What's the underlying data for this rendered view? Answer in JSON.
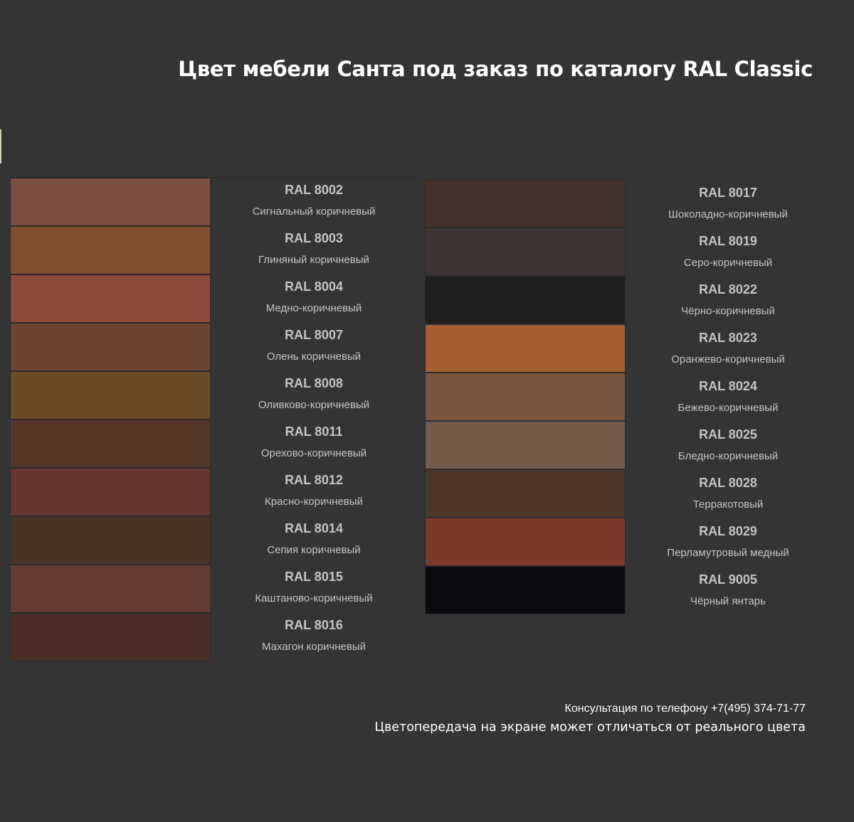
{
  "header": {
    "title": "Цвет мебели Санта под заказ по каталогу RAL Classic"
  },
  "left_colors": [
    {
      "code": "RAL 8002",
      "name": "Сигнальный коричневый",
      "color": "#7a4e41"
    },
    {
      "code": "RAL 8003",
      "name": "Глиняный коричневый",
      "color": "#7f4f2e"
    },
    {
      "code": "RAL 8004",
      "name": "Медно-коричневый",
      "color": "#8e4a38"
    },
    {
      "code": "RAL 8007",
      "name": "Олень коричневый",
      "color": "#6c452e"
    },
    {
      "code": "RAL 8008",
      "name": "Оливково-коричневый",
      "color": "#6c4b29"
    },
    {
      "code": "RAL 8011",
      "name": "Орехово-коричневый",
      "color": "#553528"
    },
    {
      "code": "RAL 8012",
      "name": "Красно-коричневый",
      "color": "#66352f"
    },
    {
      "code": "RAL 8014",
      "name": "Сепия коричневый",
      "color": "#463325"
    },
    {
      "code": "RAL 8015",
      "name": "Каштаново-коричневый",
      "color": "#643b34"
    },
    {
      "code": "RAL 8016",
      "name": "Махагон коричневый",
      "color": "#4b2d26"
    }
  ],
  "right_colors": [
    {
      "code": "RAL 8017",
      "name": "Шоколадно-коричневый",
      "color": "#43312b"
    },
    {
      "code": "RAL 8019",
      "name": "Серо-коричневый",
      "color": "#3d3433"
    },
    {
      "code": "RAL 8022",
      "name": "Чёрно-коричневый",
      "color": "#212021"
    },
    {
      "code": "RAL 8023",
      "name": "Оранжево-коричневый",
      "color": "#a65d30"
    },
    {
      "code": "RAL 8024",
      "name": "Бежево-коричневый",
      "color": "#79553d"
    },
    {
      "code": "RAL 8025",
      "name": "Бледно-коричневый",
      "color": "#735a4a"
    },
    {
      "code": "RAL 8028",
      "name": "Терракотовый",
      "color": "#4c3629"
    },
    {
      "code": "RAL 8029",
      "name": "Перламутровый медный",
      "color": "#7a3a27"
    },
    {
      "code": "RAL 9005",
      "name": "Чёрный янтарь",
      "color": "#0c0c10"
    }
  ],
  "footer": {
    "phone": "Консультация по телефону +7(495) 374-71-77",
    "disclaimer": "Цветопередача на экране может отличаться от реального цвета"
  }
}
